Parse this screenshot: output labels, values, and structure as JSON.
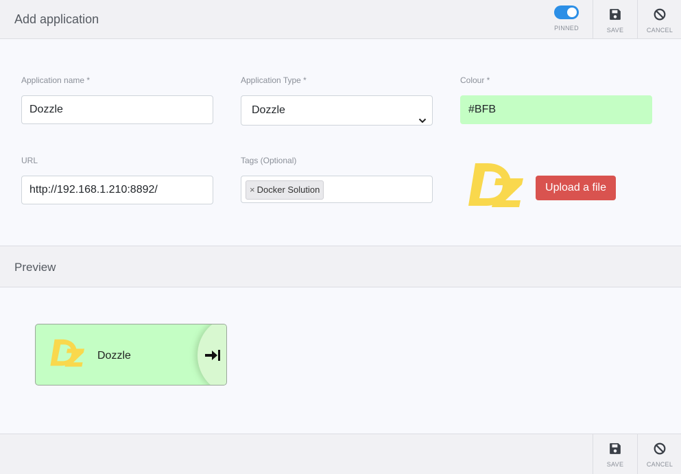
{
  "header": {
    "title": "Add application",
    "pinned_label": "PINNED",
    "save_label": "SAVE",
    "cancel_label": "CANCEL"
  },
  "form": {
    "app_name": {
      "label": "Application name *",
      "value": "Dozzle"
    },
    "app_type": {
      "label": "Application Type *",
      "value": "Dozzle"
    },
    "colour": {
      "label": "Colour *",
      "value": "#BFB"
    },
    "url": {
      "label": "URL",
      "value": "http://192.168.1.210:8892/"
    },
    "tags": {
      "label": "Tags (Optional)",
      "items": [
        "Docker Solution"
      ]
    },
    "icon_text": "DZ",
    "upload_label": "Upload a file"
  },
  "preview": {
    "title": "Preview",
    "card_name": "Dozzle"
  },
  "footer": {
    "save_label": "SAVE",
    "cancel_label": "CANCEL"
  },
  "colors": {
    "accent": "#2c8fe6",
    "upload": "#d9534f",
    "app_bg": "#c4fec4",
    "logo": "#f9d84d"
  }
}
